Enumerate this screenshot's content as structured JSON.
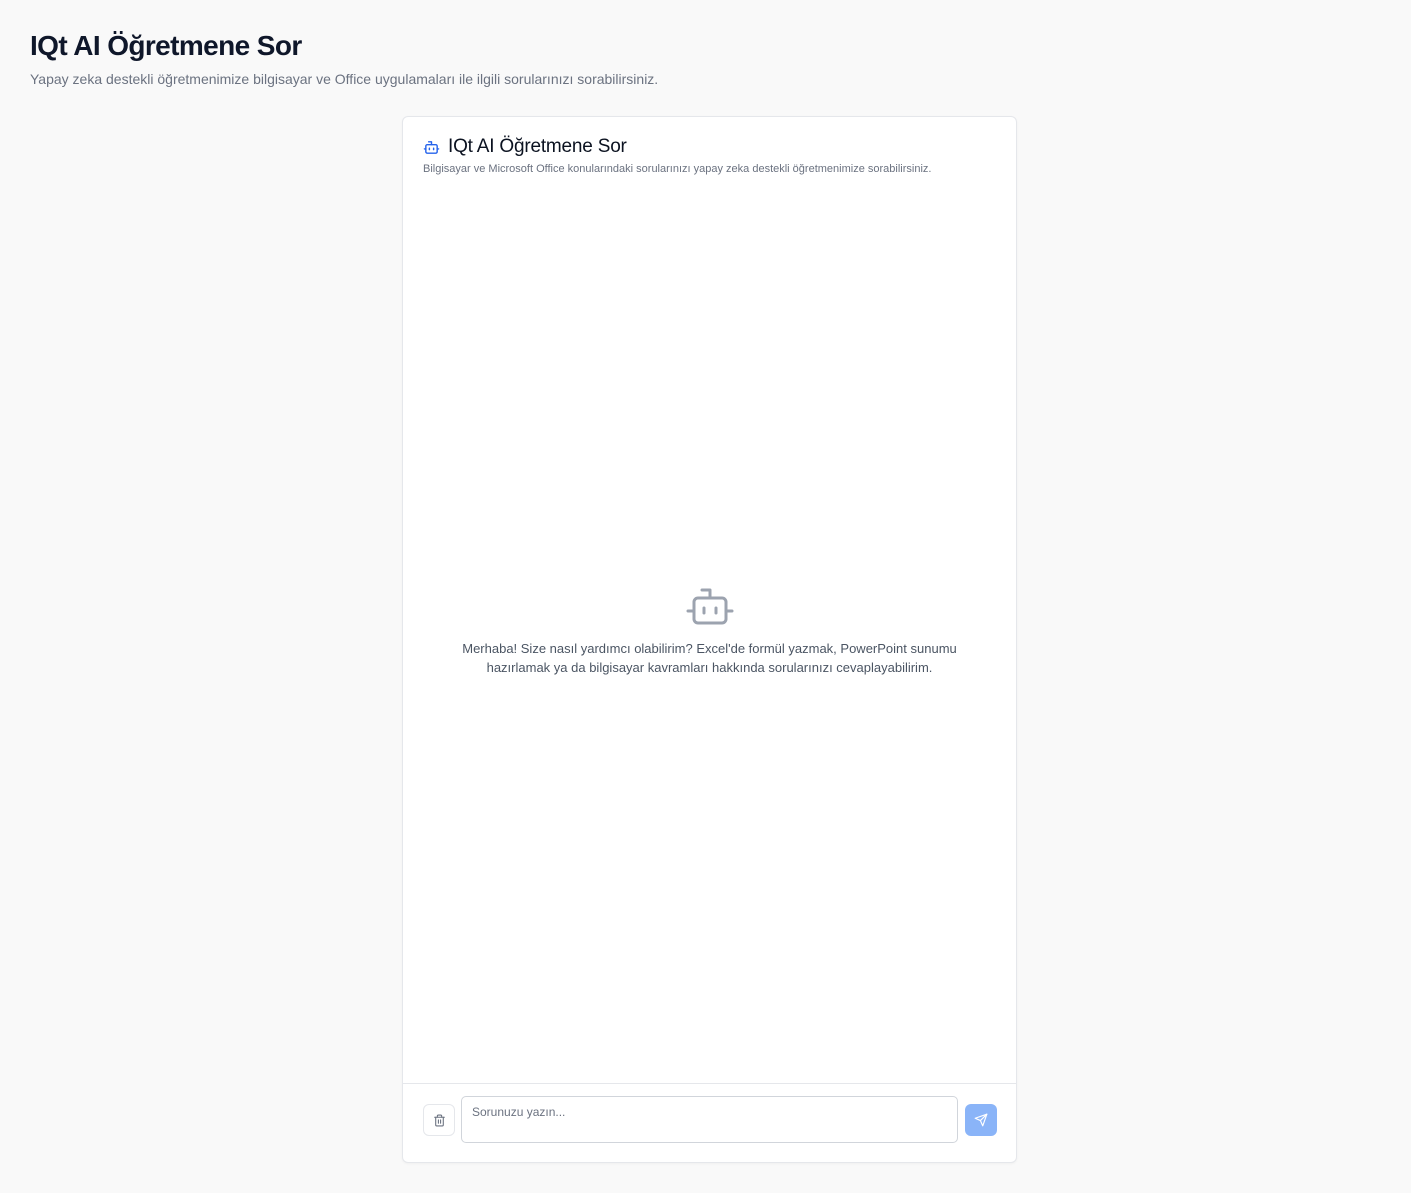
{
  "page": {
    "title": "IQt AI Öğretmene Sor",
    "subtitle": "Yapay zeka destekli öğretmenimize bilgisayar ve Office uygulamaları ile ilgili sorularınızı sorabilirsiniz."
  },
  "chat": {
    "title_icon": "bot-icon",
    "title": "IQt AI Öğretmene Sor",
    "description": "Bilgisayar ve Microsoft Office konularındaki sorularınızı yapay zeka destekli öğretmenimize sorabilirsiniz.",
    "empty_icon": "bot-icon",
    "empty_message": "Merhaba! Size nasıl yardımcı olabilirim? Excel'de formül yazmak, PowerPoint sunumu hazırlamak ya da bilgisayar kavramları hakkında sorularınızı cevaplayabilirim."
  },
  "composer": {
    "clear_icon": "trash-icon",
    "input_value": "",
    "input_placeholder": "Sorunuzu yazın...",
    "send_icon": "send-icon"
  },
  "colors": {
    "accent": "#2563eb",
    "send_button_disabled": "#8ab4f8",
    "background": "#f9f9f9"
  }
}
